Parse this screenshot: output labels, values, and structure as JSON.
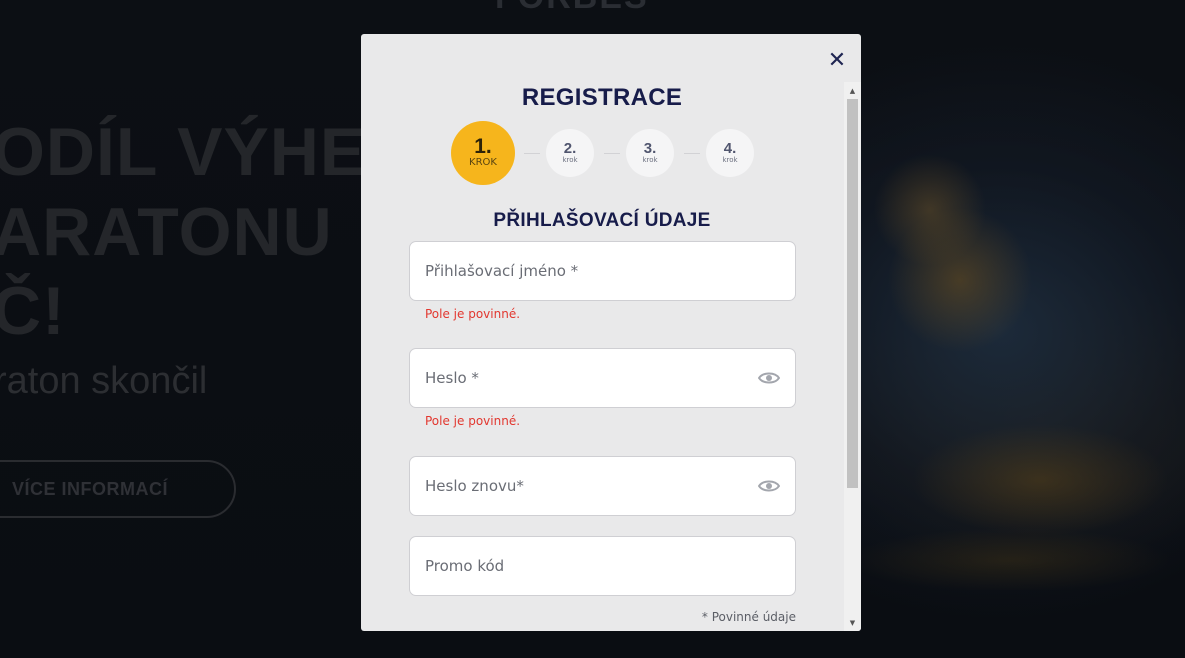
{
  "background": {
    "logo_text": "FORBES",
    "hero_line_1": "ODÍL VÝHE",
    "hero_line_2": "ARATONU",
    "hero_line_3": "Č!",
    "hero_subtitle": "raton skončil",
    "more_info_button": "VÍCE INFORMACÍ"
  },
  "modal": {
    "close_symbol": "✕",
    "title": "REGISTRACE",
    "steps": [
      {
        "number": "1.",
        "label": "KROK",
        "active": true
      },
      {
        "number": "2.",
        "label": "krok",
        "active": false
      },
      {
        "number": "3.",
        "label": "krok",
        "active": false
      },
      {
        "number": "4.",
        "label": "krok",
        "active": false
      }
    ],
    "section_title": "PŘIHLAŠOVACÍ ÚDAJE",
    "fields": {
      "username": {
        "placeholder": "Přihlašovací jméno *",
        "value": "",
        "error": "Pole je povinné."
      },
      "password": {
        "placeholder": "Heslo *",
        "value": "",
        "error": "Pole je povinné.",
        "icon": "eye-icon"
      },
      "password_repeat": {
        "placeholder": "Heslo znovu*",
        "value": "",
        "icon": "eye-icon"
      },
      "promo_code": {
        "placeholder": "Promo kód",
        "value": ""
      }
    },
    "required_note": "* Povinné údaje"
  },
  "colors": {
    "accent_step": "#f6b51c",
    "title_navy": "#171c4a",
    "error_red": "#e2372f",
    "modal_bg": "#e9e9ea"
  }
}
